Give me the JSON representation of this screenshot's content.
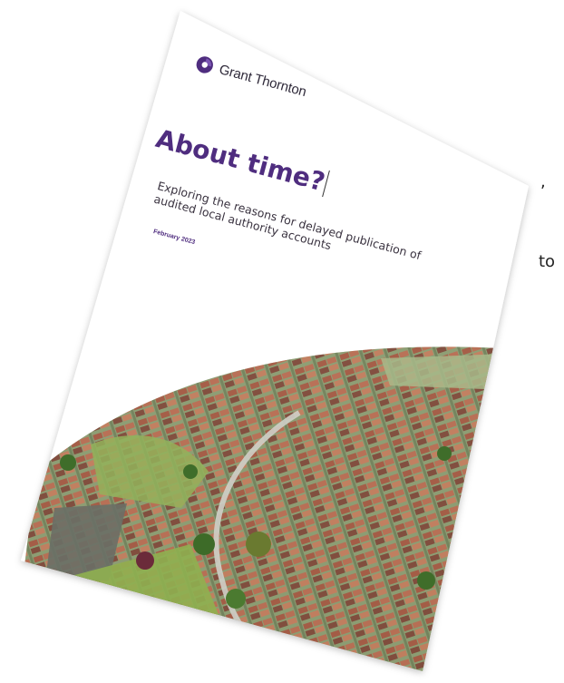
{
  "left_fragments": {
    "comma": ",",
    "line1": ",",
    "line2": "to"
  },
  "report": {
    "brand": "Grant Thornton",
    "title": "About time?",
    "subtitle_line1": "Exploring the reasons for delayed publication of",
    "subtitle_line2": "audited local authority accounts",
    "date": "February 2023"
  },
  "colors": {
    "brand_purple": "#4f2d7f",
    "paper": "#ffffff",
    "text": "#3a3340"
  },
  "icons": {
    "logo": "grant-thornton-logo-icon"
  }
}
